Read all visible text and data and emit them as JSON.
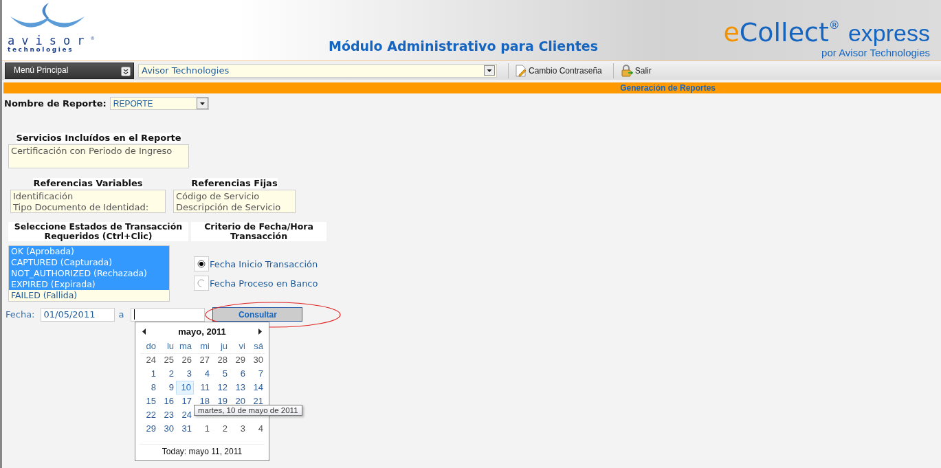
{
  "header": {
    "logo_name": "avisor",
    "logo_reg": "®",
    "logo_sub": "technologies",
    "title": "Módulo Administrativo para Clientes",
    "brand_e": "e",
    "brand_main": "Collect",
    "brand_reg": "®",
    "brand_tail": "express",
    "brand_by": "por Avisor Technologies"
  },
  "toolbar": {
    "menu_button": "Menú Principal",
    "client_select": "Avisor Technologies",
    "actions": [
      {
        "kind": "password",
        "label": "Cambio Contraseña"
      },
      {
        "kind": "logout",
        "label": "Salir"
      }
    ]
  },
  "section_bar": "Generación de Reportes",
  "report": {
    "label": "Nombre de Reporte:",
    "value": "REPORTE"
  },
  "services": {
    "heading": "Servicios Incluídos en el Reporte",
    "items": [
      "Certificación con Periodo de Ingreso"
    ]
  },
  "references": [
    {
      "heading": "Referencias Variables",
      "items": [
        "Identificación",
        "Tipo Documento de Identidad:"
      ]
    },
    {
      "heading": "Referencias Fijas",
      "items": [
        "Código de Servicio",
        "Descripción de Servicio"
      ]
    }
  ],
  "states": {
    "heading": "Seleccione Estados de Transacción Requeridos (Ctrl+Clic)",
    "options": [
      {
        "label": "OK (Aprobada)",
        "selected": true
      },
      {
        "label": "CAPTURED (Capturada)",
        "selected": true
      },
      {
        "label": "NOT_AUTHORIZED (Rechazada)",
        "selected": true
      },
      {
        "label": "EXPIRED (Expirada)",
        "selected": true
      },
      {
        "label": "FAILED (Fallida)",
        "selected": false
      }
    ]
  },
  "date_criteria": {
    "heading": "Criterio de Fecha/Hora Transacción",
    "options": [
      {
        "label": "Fecha Inicio Transacción",
        "selected": true
      },
      {
        "label": "Fecha Proceso en Banco",
        "selected": false
      }
    ]
  },
  "date_range": {
    "label": "Fecha:",
    "from": "01/05/2011",
    "separator": "a",
    "submit": "Consultar",
    "submit_highlighted": true
  },
  "calendar": {
    "month": "mayo, 2011",
    "weekdays": [
      "do",
      "lu",
      "ma",
      "mi",
      "ju",
      "vi",
      "sá"
    ],
    "weeks": [
      [
        {
          "label": "24",
          "other": true,
          "selected": false
        },
        {
          "label": "25",
          "other": true,
          "selected": false
        },
        {
          "label": "26",
          "other": true,
          "selected": false
        },
        {
          "label": "27",
          "other": true,
          "selected": false
        },
        {
          "label": "28",
          "other": true,
          "selected": false
        },
        {
          "label": "29",
          "other": true,
          "selected": false
        },
        {
          "label": "30",
          "other": true,
          "selected": false
        }
      ],
      [
        {
          "label": "1",
          "other": false,
          "selected": false
        },
        {
          "label": "2",
          "other": false,
          "selected": false
        },
        {
          "label": "3",
          "other": false,
          "selected": false
        },
        {
          "label": "4",
          "other": false,
          "selected": false
        },
        {
          "label": "5",
          "other": false,
          "selected": false
        },
        {
          "label": "6",
          "other": false,
          "selected": false
        },
        {
          "label": "7",
          "other": false,
          "selected": false
        }
      ],
      [
        {
          "label": "8",
          "other": false,
          "selected": false
        },
        {
          "label": "9",
          "other": false,
          "selected": false
        },
        {
          "label": "10",
          "other": false,
          "selected": true
        },
        {
          "label": "11",
          "other": false,
          "selected": false
        },
        {
          "label": "12",
          "other": false,
          "selected": false
        },
        {
          "label": "13",
          "other": false,
          "selected": false
        },
        {
          "label": "14",
          "other": false,
          "selected": false
        }
      ],
      [
        {
          "label": "15",
          "other": false,
          "selected": false
        },
        {
          "label": "16",
          "other": false,
          "selected": false
        },
        {
          "label": "17",
          "other": false,
          "selected": false
        },
        {
          "label": "18",
          "other": false,
          "selected": false
        },
        {
          "label": "19",
          "other": false,
          "selected": false
        },
        {
          "label": "20",
          "other": false,
          "selected": false
        },
        {
          "label": "21",
          "other": false,
          "selected": false
        }
      ],
      [
        {
          "label": "22",
          "other": false,
          "selected": false
        },
        {
          "label": "23",
          "other": false,
          "selected": false
        },
        {
          "label": "24",
          "other": false,
          "selected": false
        }
      ],
      [
        {
          "label": "29",
          "other": false,
          "selected": false
        },
        {
          "label": "30",
          "other": false,
          "selected": false
        },
        {
          "label": "31",
          "other": false,
          "selected": false
        },
        {
          "label": "1",
          "other": true,
          "selected": false
        },
        {
          "label": "2",
          "other": true,
          "selected": false
        },
        {
          "label": "3",
          "other": true,
          "selected": false
        },
        {
          "label": "4",
          "other": true,
          "selected": false
        }
      ]
    ],
    "today": "Today: mayo 11, 2011",
    "tooltip": "martes, 10 de mayo de 2011"
  }
}
